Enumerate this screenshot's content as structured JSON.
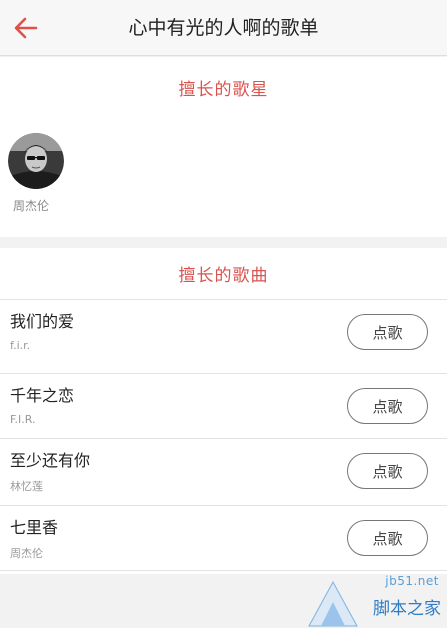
{
  "header": {
    "title": "心中有光的人啊的歌单",
    "back_icon": "arrow-left-icon",
    "accent_color": "#e0504a"
  },
  "stars_section": {
    "title": "擅长的歌星",
    "title_color": "#d9534f",
    "singers": [
      {
        "name": "周杰伦",
        "avatar_icon": "singer-avatar-photo"
      }
    ]
  },
  "songs_section": {
    "title": "擅长的歌曲",
    "songs": [
      {
        "title": "我们的爱",
        "artist": "f.i.r.",
        "button_label": "点歌"
      },
      {
        "title": "千年之恋",
        "artist": "F.I.R.",
        "button_label": "点歌"
      },
      {
        "title": "至少还有你",
        "artist": "林忆莲",
        "button_label": "点歌"
      },
      {
        "title": "七里香",
        "artist": "周杰伦",
        "button_label": "点歌"
      }
    ]
  },
  "watermark": {
    "site": "jb51.net",
    "name": "脚本之家"
  }
}
